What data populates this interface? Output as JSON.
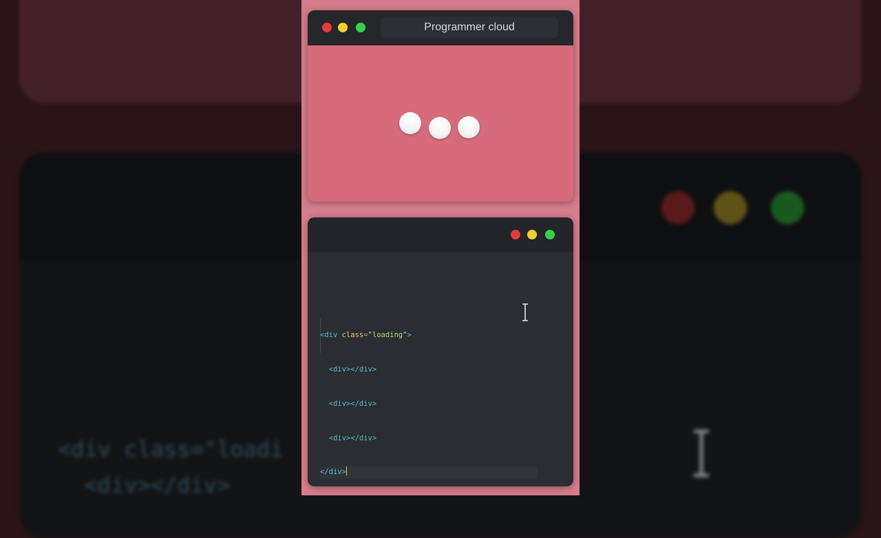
{
  "preview_window": {
    "title": "Programmer cloud"
  },
  "editor": {
    "lines": [
      {
        "open": "<div ",
        "attr": "class",
        "eq": "=",
        "str": "\"loading\"",
        "close": ">"
      },
      {
        "text": "  <div></div>"
      },
      {
        "text": "  <div></div>"
      },
      {
        "text": "  <div></div>"
      },
      {
        "text": "</div>"
      }
    ]
  },
  "background": {
    "code_line_1": "<div class=\"loadi",
    "code_line_2": "  <div></div>"
  },
  "colors": {
    "accent_pink": "#d77c8a",
    "traffic_red": "#e33b3b",
    "traffic_yellow": "#f0d02b",
    "traffic_green": "#35d04a"
  },
  "icons": [
    "close-dot-icon",
    "minimize-dot-icon",
    "maximize-dot-icon",
    "text-cursor-icon"
  ]
}
